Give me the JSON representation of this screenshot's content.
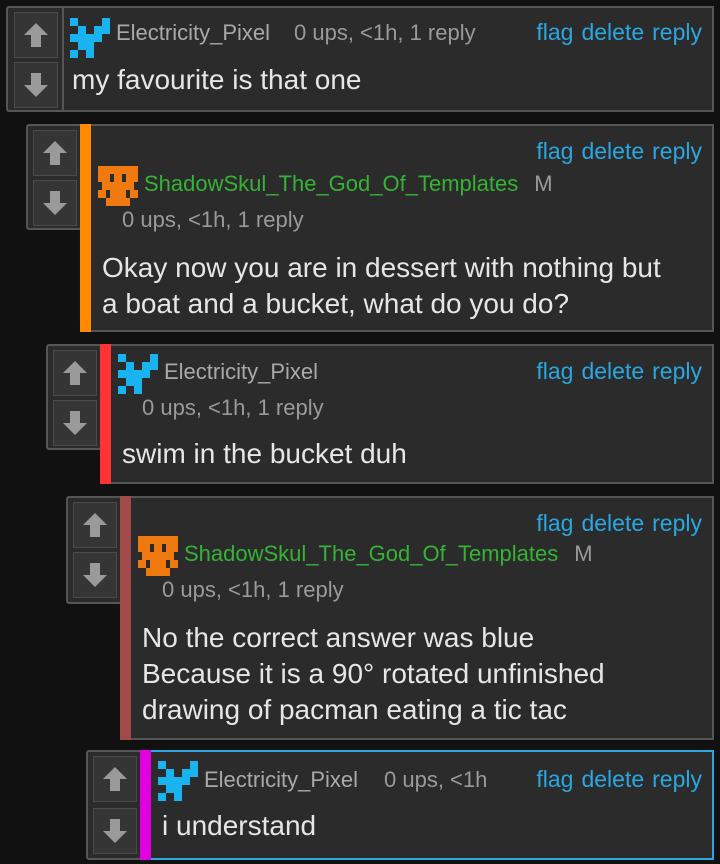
{
  "colors": {
    "background": "#111111",
    "panel": "#2b2b2b",
    "link": "#2aa7e0",
    "moderator_name": "#35b335",
    "stripe_orange": "#ff8c00",
    "stripe_red": "#ff3333",
    "stripe_brown": "#a04a4a",
    "stripe_magenta": "#e000e0",
    "highlight_border": "#2aa7e0",
    "avatar_blue": "#19b3f0",
    "avatar_orange": "#f07a10"
  },
  "actions": {
    "flag": "flag",
    "delete": "delete",
    "reply": "reply"
  },
  "comments": [
    {
      "author": "Electricity_Pixel",
      "meta": "0 ups, <1h, 1 reply",
      "text": "my favourite is that one",
      "avatar_icon": "blue-pixel-avatar-icon"
    },
    {
      "author": "ShadowSkul_The_God_Of_Templates",
      "badge": "M",
      "meta": "0 ups, <1h, 1 reply",
      "text_lines": [
        "Okay now you are in dessert with nothing but",
        "a boat and a bucket, what do you do?"
      ],
      "avatar_icon": "orange-skull-avatar-icon"
    },
    {
      "author": "Electricity_Pixel",
      "meta": "0 ups, <1h, 1 reply",
      "text": "swim in the bucket duh",
      "avatar_icon": "blue-pixel-avatar-icon"
    },
    {
      "author": "ShadowSkul_The_God_Of_Templates",
      "badge": "M",
      "meta": "0 ups, <1h, 1 reply",
      "text_lines": [
        "No the correct answer was blue",
        "Because it is a 90° rotated unfinished",
        "drawing of pacman eating a tic tac"
      ],
      "avatar_icon": "orange-skull-avatar-icon"
    },
    {
      "author": "Electricity_Pixel",
      "meta": "0 ups, <1h",
      "text": "i understand",
      "avatar_icon": "blue-pixel-avatar-icon"
    }
  ]
}
